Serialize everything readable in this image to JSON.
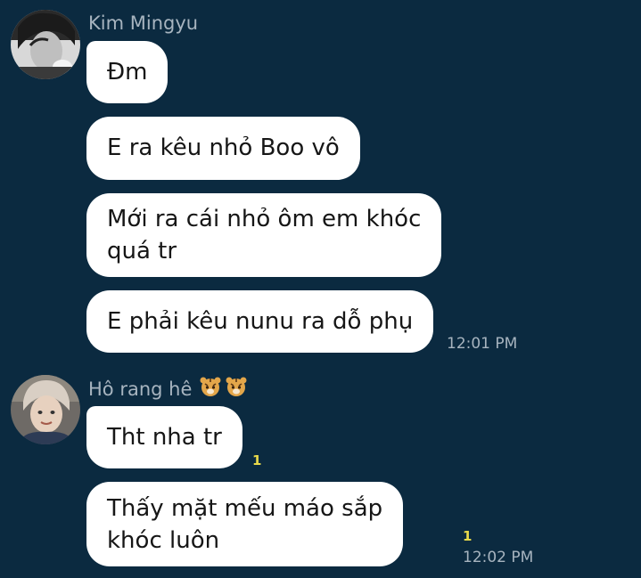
{
  "colors": {
    "background": "#0b2a40",
    "bubble": "#ffffff",
    "bubble_text": "#161616",
    "meta_text": "#a7b4bf",
    "unread": "#e8d94a"
  },
  "groups": [
    {
      "sender": "Kim Mingyu",
      "avatar": "avatar-kim-mingyu",
      "messages": [
        {
          "lines": [
            "Đm"
          ]
        },
        {
          "lines": [
            "E ra kêu nhỏ Boo vô"
          ]
        },
        {
          "lines": [
            "Mới ra cái nhỏ ôm em khóc",
            "quá tr"
          ]
        },
        {
          "lines": [
            "E phải kêu nunu ra dỗ phụ"
          ],
          "time": "12:01 PM"
        }
      ]
    },
    {
      "sender": "Hô rang hê",
      "sender_emoji_icon": "tiger-face-icon",
      "avatar": "avatar-ho-rang-he",
      "messages": [
        {
          "lines": [
            "Tht nha tr"
          ],
          "unread": "1"
        },
        {
          "lines": [
            "Thấy mặt mếu máo sắp",
            "khóc luôn"
          ],
          "unread": "1",
          "time": "12:02 PM"
        }
      ]
    }
  ]
}
